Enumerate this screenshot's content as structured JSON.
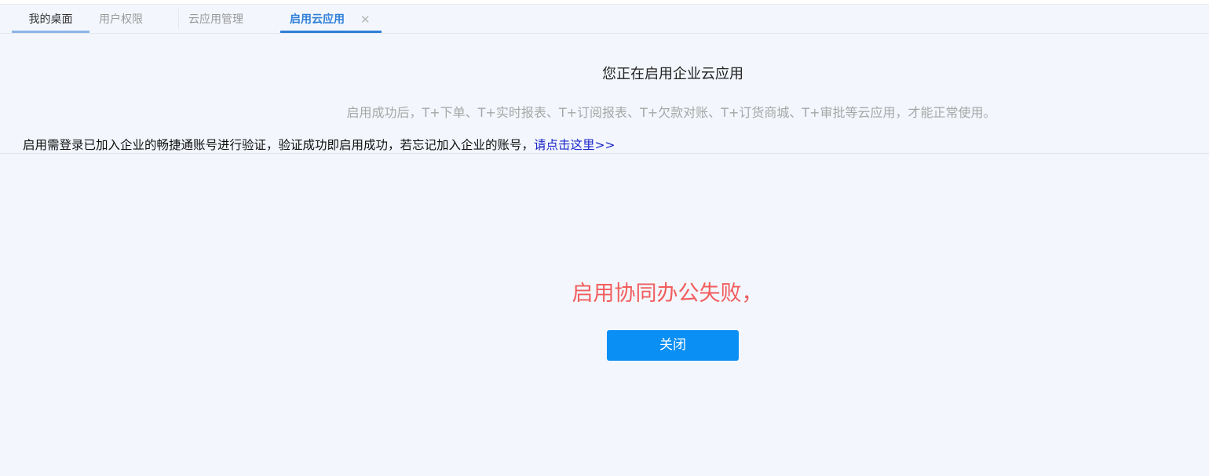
{
  "tabs": [
    {
      "label": "我的桌面"
    },
    {
      "label": "用户权限"
    },
    {
      "label": "云应用管理"
    },
    {
      "label": "启用云应用",
      "close_glyph": "✕"
    }
  ],
  "main": {
    "heading": "您正在启用企业云应用",
    "subline": "启用成功后，T+下单、T+实时报表、T+订阅报表、T+欠款对账、T+订货商城、T+审批等云应用，才能正常使用。",
    "info_text": "启用需登录已加入企业的畅捷通账号进行验证，验证成功即启用成功，若忘记加入企业的账号，",
    "info_link": "请点击这里>>",
    "fail_message": "启用协同办公失败，",
    "close_button": "关闭"
  },
  "colors": {
    "background": "#f3f7fd",
    "active_tab": "#2f7fd8",
    "link": "#1a24c8",
    "error": "#f25d5d",
    "button": "#0a8ff5"
  }
}
